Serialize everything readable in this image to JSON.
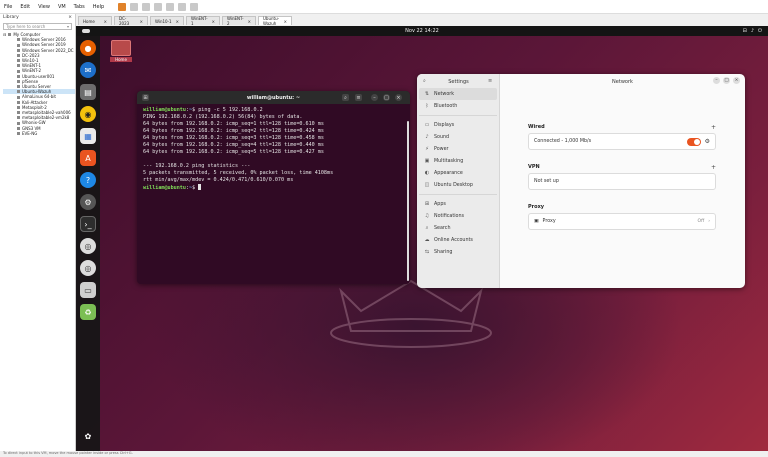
{
  "host": {
    "menu": [
      "File",
      "Edit",
      "View",
      "VM",
      "Tabs",
      "Help"
    ],
    "library_title": "Library",
    "library_close": "×",
    "search_placeholder": "Type here to search",
    "tree_root": "My Computer",
    "vms": [
      "Windows Server 2016",
      "Windows Server 2019",
      "Windows Server 2022_DC",
      "DC-2023",
      "Win10-1",
      "WinENT-1",
      "WinENT-2",
      "Ubuntu-user001",
      "pfSense",
      "Ubuntu Server",
      "Ubuntu-Wazuh",
      "AlmaLinux 64-bit",
      "Kali-Attacker",
      "Metasploit-2",
      "metasploitable2-vah006",
      "metasploitable2-vm2k8",
      "Whonix-GW",
      "GNS3 VM",
      "EVE-NG"
    ],
    "selected_vm_index": 10,
    "tabs": [
      {
        "label": "Home",
        "active": false
      },
      {
        "label": "DC-2023",
        "active": false
      },
      {
        "label": "Win10-1",
        "active": false
      },
      {
        "label": "WinENT-1",
        "active": false
      },
      {
        "label": "WinENT-2",
        "active": false
      },
      {
        "label": "Ubuntu-Wazuh",
        "active": true
      }
    ],
    "tab_close": "×",
    "status_text": "To direct input to this VM, move the mouse pointer inside or press Ctrl+G."
  },
  "guest": {
    "clock": "Nov 22  14:22",
    "tray": [
      "⊟",
      "♪",
      "⏻"
    ],
    "desktop_home_label": "Home",
    "terminal": {
      "title": "william@ubuntu: ~",
      "prompt_user": "william@ubuntu",
      "prompt_path": "~",
      "prompt_suffix": "$",
      "command": " ping -c 5 192.168.0.2",
      "output": [
        "PING 192.168.0.2 (192.168.0.2) 56(84) bytes of data.",
        "64 bytes from 192.168.0.2: icmp_seq=1 ttl=128 time=0.610 ms",
        "64 bytes from 192.168.0.2: icmp_seq=2 ttl=128 time=0.424 ms",
        "64 bytes from 192.168.0.2: icmp_seq=3 ttl=128 time=0.458 ms",
        "64 bytes from 192.168.0.2: icmp_seq=4 ttl=128 time=0.440 ms",
        "64 bytes from 192.168.0.2: icmp_seq=5 ttl=128 time=0.427 ms",
        "",
        "--- 192.168.0.2 ping statistics ---",
        "5 packets transmitted, 5 received, 0% packet loss, time 4108ms",
        "rtt min/avg/max/mdev = 0.424/0.471/0.610/0.070 ms"
      ]
    },
    "settings": {
      "sidebar_title": "Settings",
      "panel_title": "Network",
      "nav": [
        {
          "label": "Network",
          "icon": "network-icon",
          "glyph": "⇅",
          "active": true
        },
        {
          "label": "Bluetooth",
          "icon": "bluetooth-icon",
          "glyph": "ᛒ",
          "active": false
        },
        {
          "label": "Displays",
          "icon": "display-icon",
          "glyph": "▭",
          "active": false
        },
        {
          "label": "Sound",
          "icon": "sound-icon",
          "glyph": "♪",
          "active": false
        },
        {
          "label": "Power",
          "icon": "power-icon",
          "glyph": "⚡",
          "active": false
        },
        {
          "label": "Multitasking",
          "icon": "multitasking-icon",
          "glyph": "▣",
          "active": false
        },
        {
          "label": "Appearance",
          "icon": "appearance-icon",
          "glyph": "◐",
          "active": false
        },
        {
          "label": "Ubuntu Desktop",
          "icon": "ubuntu-desktop-icon",
          "glyph": "◫",
          "active": false
        },
        {
          "label": "Apps",
          "icon": "apps-icon",
          "glyph": "⊞",
          "active": false
        },
        {
          "label": "Notifications",
          "icon": "notifications-icon",
          "glyph": "♫",
          "active": false
        },
        {
          "label": "Search",
          "icon": "search-icon",
          "glyph": "⌕",
          "active": false
        },
        {
          "label": "Online Accounts",
          "icon": "online-accounts-icon",
          "glyph": "☁",
          "active": false
        },
        {
          "label": "Sharing",
          "icon": "sharing-icon",
          "glyph": "⇆",
          "active": false
        }
      ],
      "wired": {
        "heading": "Wired",
        "status": "Connected - 1,000 Mb/s",
        "enabled": true
      },
      "vpn": {
        "heading": "VPN",
        "status": "Not set up"
      },
      "proxy": {
        "heading": "Proxy",
        "label": "Proxy",
        "value": "Off"
      },
      "add": "+"
    }
  },
  "colors": {
    "ubuntu_orange": "#e95420",
    "terminal_bg": "#300a24",
    "prompt_green": "#7ed957",
    "prompt_blue": "#6fa8dc"
  }
}
